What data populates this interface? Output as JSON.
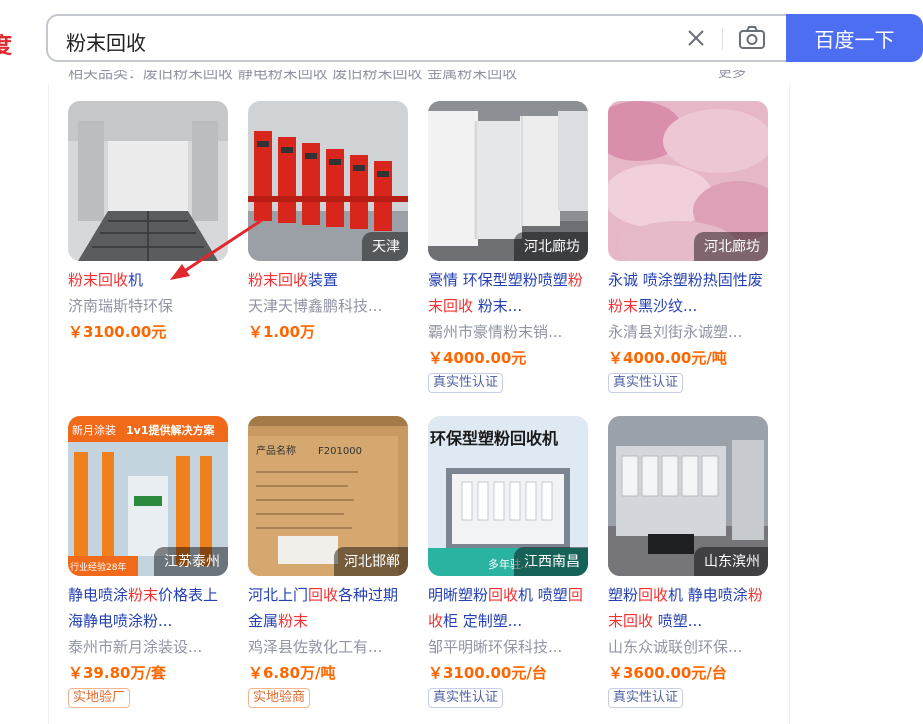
{
  "logo_text": "度",
  "search": {
    "query": "粉末回收",
    "button_label": "百度一下"
  },
  "category_row": "相关品类：废旧粉末回收  静电粉末回收  废旧粉末回收  金属粉末回收",
  "more_label": "更多",
  "products": [
    {
      "title_parts": [
        {
          "t": "粉末回收",
          "hl": true
        },
        {
          "t": "机",
          "hl": false
        }
      ],
      "shop": "济南瑞斯特环保",
      "price": "￥3100.00元",
      "location": "",
      "badge": ""
    },
    {
      "title_parts": [
        {
          "t": "粉末回收",
          "hl": true
        },
        {
          "t": "装置",
          "hl": false
        }
      ],
      "shop": "天津天博鑫鹏科技...",
      "price": "￥1.00万",
      "location": "天津",
      "badge": ""
    },
    {
      "title_parts": [
        {
          "t": "豪情 环保型塑粉喷塑",
          "hl": false
        },
        {
          "t": "粉末回收",
          "hl": true
        },
        {
          "t": " 粉末...",
          "hl": false
        }
      ],
      "shop": "霸州市豪情粉末销...",
      "price": "￥4000.00元",
      "location": "河北廊坊",
      "badge": "真实性认证"
    },
    {
      "title_parts": [
        {
          "t": "永诚 喷涂塑粉热固性废",
          "hl": false
        },
        {
          "t": "粉末",
          "hl": true
        },
        {
          "t": "黑沙纹...",
          "hl": false
        }
      ],
      "shop": "永清县刘街永诚塑...",
      "price": "￥4000.00元/吨",
      "location": "河北廊坊",
      "badge": "真实性认证"
    },
    {
      "title_parts": [
        {
          "t": "静电喷涂",
          "hl": false
        },
        {
          "t": "粉末",
          "hl": true
        },
        {
          "t": "价格表上海静电喷涂粉...",
          "hl": false
        }
      ],
      "shop": "泰州市新月涂装设...",
      "price": "￥39.80万/套",
      "location": "江苏泰州",
      "badge": "实地验厂"
    },
    {
      "title_parts": [
        {
          "t": "河北上门",
          "hl": false
        },
        {
          "t": "回收",
          "hl": true
        },
        {
          "t": "各种过期金属",
          "hl": false
        },
        {
          "t": "粉末",
          "hl": true
        }
      ],
      "shop": "鸡泽县佐敦化工有...",
      "price": "￥6.80万/吨",
      "location": "河北邯郸",
      "badge": "实地验商"
    },
    {
      "title_parts": [
        {
          "t": "明晰塑粉",
          "hl": false
        },
        {
          "t": "回收",
          "hl": true
        },
        {
          "t": "机 喷塑",
          "hl": false
        },
        {
          "t": "回收",
          "hl": true
        },
        {
          "t": "柜 定制塑...",
          "hl": false
        }
      ],
      "shop": "邹平明晰环保科技...",
      "price": "￥3100.00元/台",
      "location": "江西南昌",
      "badge": "真实性认证"
    },
    {
      "title_parts": [
        {
          "t": "塑粉",
          "hl": false
        },
        {
          "t": "回收",
          "hl": true
        },
        {
          "t": "机 静电喷涂",
          "hl": false
        },
        {
          "t": "粉末回收",
          "hl": true
        },
        {
          "t": " 喷塑...",
          "hl": false
        }
      ],
      "shop": "山东众诚联创环保...",
      "price": "￥3600.00元/台",
      "location": "山东滨州",
      "badge": "真实性认证"
    }
  ],
  "thumb_texts": {
    "p5_banner": "新月涂装",
    "p5_banner2": "1v1提供解决方案",
    "p5_footer": "行业经验28年",
    "p6_box": "产品名称",
    "p6_code": "F201000",
    "p7_banner": "环保型塑粉回收机",
    "p7_footer": "多年驻..."
  },
  "colors": {
    "brand_blue": "#4e6ef2",
    "highlight_red": "#f73131",
    "link_blue": "#2440b3",
    "price_orange": "#ff6600",
    "arrow_red": "#e0282e"
  }
}
